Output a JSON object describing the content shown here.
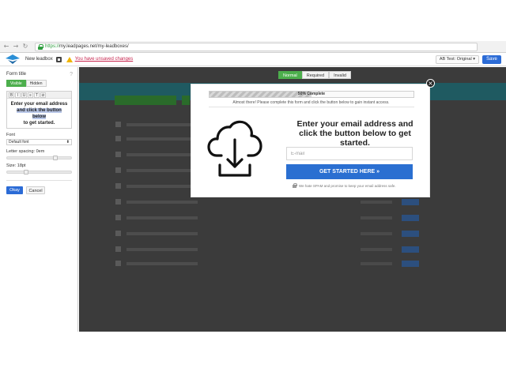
{
  "browser": {
    "url_scheme": "https://",
    "url_rest": "my.leadpages.net/my-leadboxes/"
  },
  "appbar": {
    "leadbox_name": "New leadbox",
    "unsaved_warning": "You have unsaved changes",
    "abtest_label": "AB Test: Original ▾",
    "save_label": "Save"
  },
  "panel": {
    "title": "Form title",
    "visibility": {
      "visible": "Visible",
      "hidden": "Hidden"
    },
    "toolbar": [
      "B",
      "I",
      "U",
      "≡",
      "T",
      "⊘"
    ],
    "editor_lines": {
      "line1": "Enter your email address",
      "line2": "and click the button below",
      "line3": "to get started."
    },
    "font_label": "Font",
    "font_value": "Default font",
    "letter_spacing_label": "Letter spacing: 0em",
    "letter_spacing_level": 0.75,
    "size_label": "Size: 18pt",
    "size_level": 0.3,
    "okay_label": "Okay",
    "cancel_label": "Cancel"
  },
  "template_tabs": [
    "Normal",
    "Required",
    "Invalid"
  ],
  "modal": {
    "progress_label": "50% Complete",
    "progress_percent": 50,
    "almost_text": "Almost there! Please complete this form and click the button below to gain instant access.",
    "headline": "Enter your email address and click the button below to get started.",
    "email_placeholder": "E-mail",
    "cta_label": "GET STARTED HERE »",
    "spam_text": "We hate SPAM and promise to keep your email address safe.",
    "close_glyph": "×",
    "icon": "cloud-download-icon"
  },
  "colors": {
    "accent_blue": "#2a6fd1",
    "active_green": "#4cae4c",
    "warning_red": "#c7254e"
  }
}
